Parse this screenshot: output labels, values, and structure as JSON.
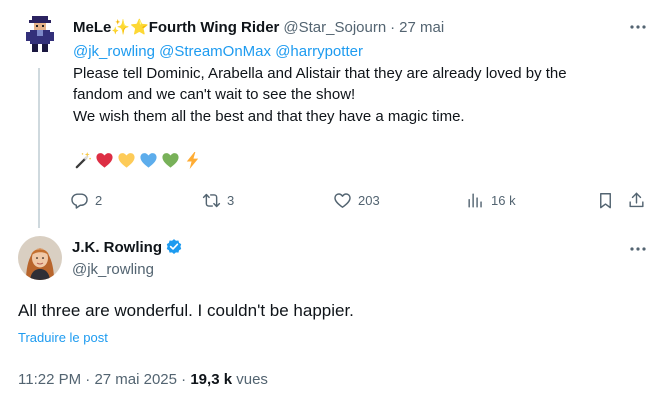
{
  "reply": {
    "author_name": "MeLe",
    "author_name_emoji": "✨⭐",
    "author_name_suffix": "Fourth Wing Rider",
    "handle": "@Star_Sojourn",
    "separator": "·",
    "date": "27 mai",
    "mentions": [
      "@jk_rowling",
      "@StreamOnMax",
      "@harrypotter"
    ],
    "line1": "Please tell Dominic, Arabella and Alistair that they are already loved by the",
    "line2": "fandom and we can't wait to see the show!",
    "line3": "We wish them all the best and that they have a magic time.",
    "emojis": [
      "magic-wand",
      "red-heart",
      "yellow-heart",
      "blue-heart",
      "green-heart",
      "lightning"
    ],
    "actions": {
      "replies": "2",
      "reposts": "3",
      "likes": "203",
      "views": "16 k"
    }
  },
  "main": {
    "author_name": "J.K. Rowling",
    "handle": "@jk_rowling",
    "text": "All three are wonderful. I couldn't be happier.",
    "translate_label": "Traduire le post",
    "time": "11:22 PM",
    "separator": "·",
    "date": "27 mai 2025",
    "views_count": "19,3 k",
    "views_label": "vues"
  },
  "colors": {
    "accent": "#1d9bf0",
    "text": "#0f1419",
    "muted": "#536471",
    "thread_line": "#cfd9de"
  }
}
